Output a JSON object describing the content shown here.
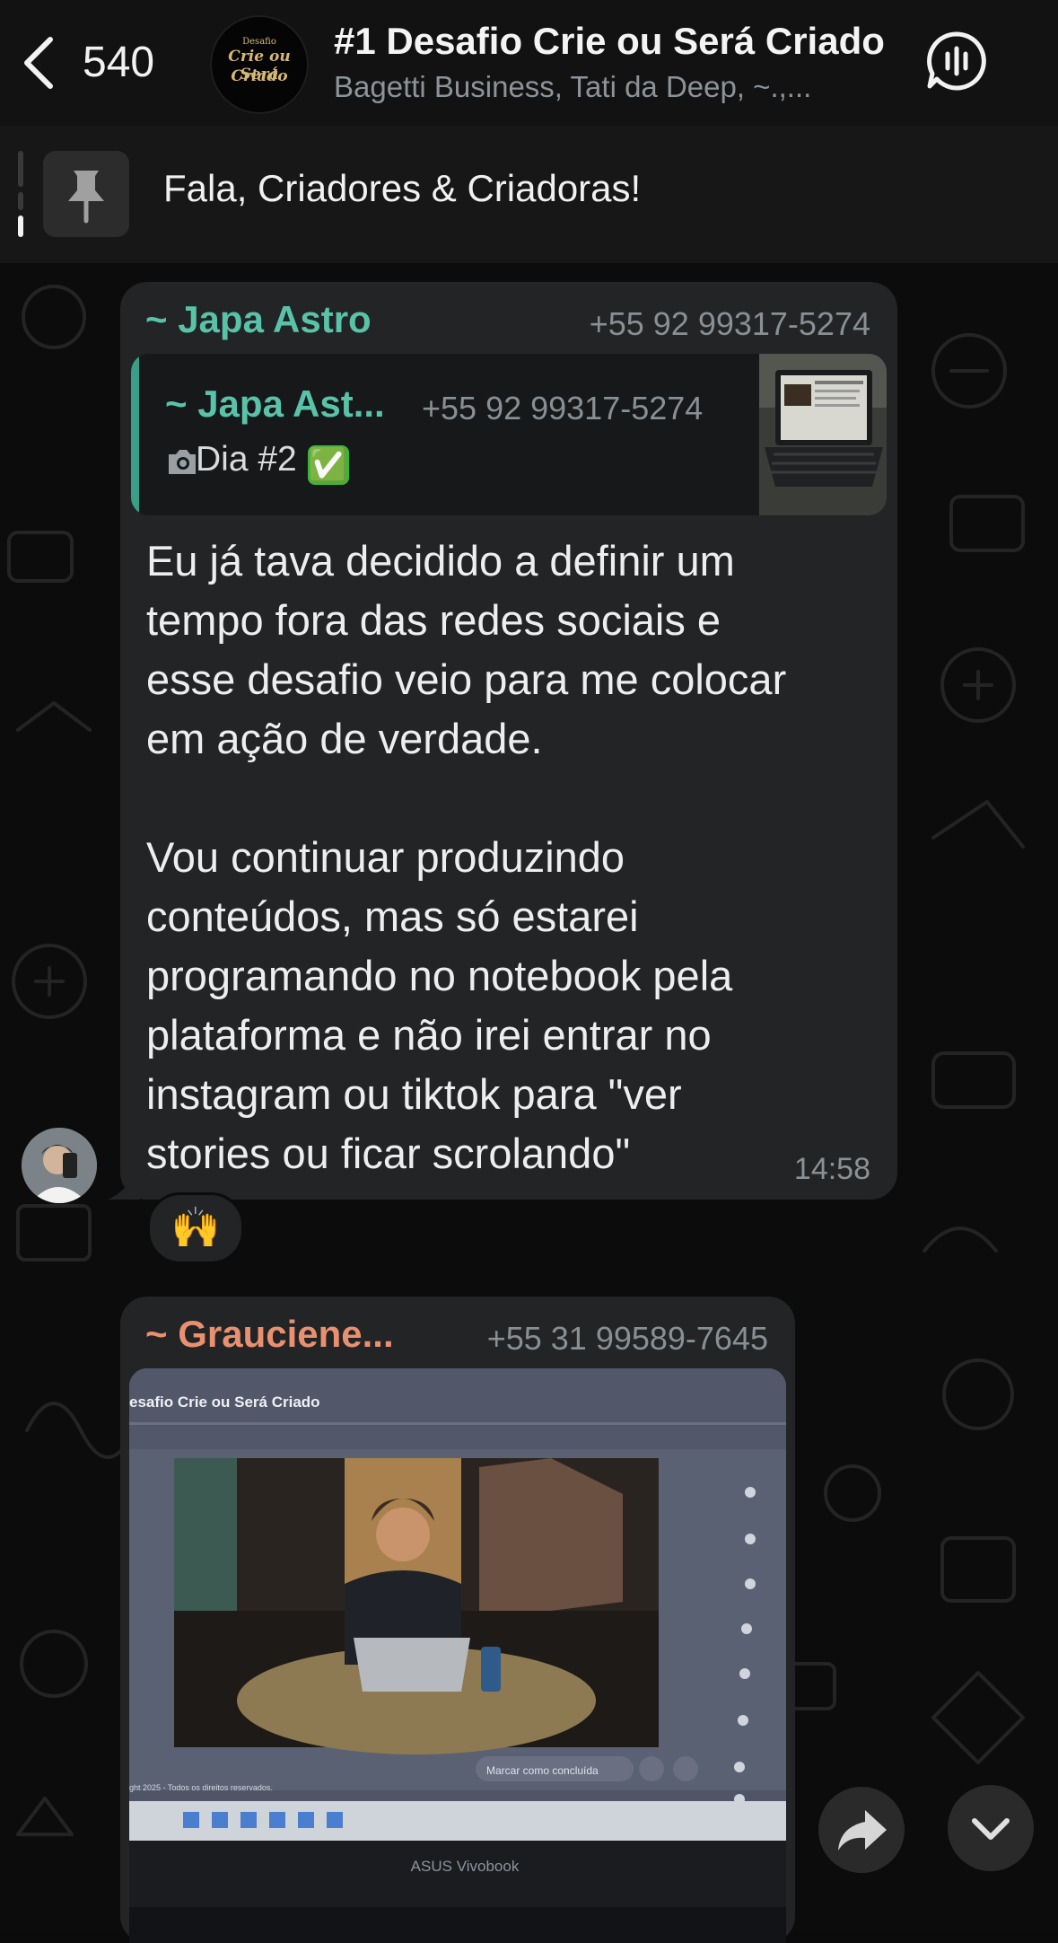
{
  "header": {
    "back_count": "540",
    "group_avatar": {
      "line1": "Desafio",
      "line2": "Crie ou Será",
      "line3": "Criado"
    },
    "title": "#1 Desafio Crie ou Será Criado",
    "members": "Bagetti Business, Tati da Deep, ~.,..."
  },
  "pinned": {
    "text": "Fala, Criadores & Criadoras!"
  },
  "messages": [
    {
      "sender": "~ Japa Astro",
      "phone": "+55 92 99317-5274",
      "sender_color": "#59c3a9",
      "quote": {
        "sender": "~ Japa Ast...",
        "phone": "+55 92 99317-5274",
        "text": "Dia #2",
        "icon": "camera-icon",
        "emoji": "✅"
      },
      "text": "Eu já tava decidido a definir um\ntempo fora das redes sociais e\nesse desafio veio para me colocar\nem ação de verdade.\n\nVou continuar produzindo\nconteúdos, mas só estarei\nprogramando no notebook pela\nplataforma e não irei entrar no\ninstagram ou tiktok para \"ver\nstories ou ficar scrolando\"",
      "time": "14:58",
      "reaction": "🙌"
    },
    {
      "sender": "~ Grauciene...",
      "phone": "+55 31 99589-7645",
      "sender_color": "#e8906f",
      "image": {
        "screen_title": "esafio Crie ou Será Criado",
        "button_text": "Marcar como concluída",
        "laptop_brand": "ASUS Vivobook",
        "footer_text": "ght 2025 - Todos os direitos reservados."
      }
    }
  ],
  "fab": {
    "forward_icon": "forward-arrow-icon",
    "scroll_icon": "chevron-down-icon"
  },
  "colors": {
    "background": "#0c0c0c",
    "bubble": "#222425",
    "accent": "#59c3a9"
  }
}
